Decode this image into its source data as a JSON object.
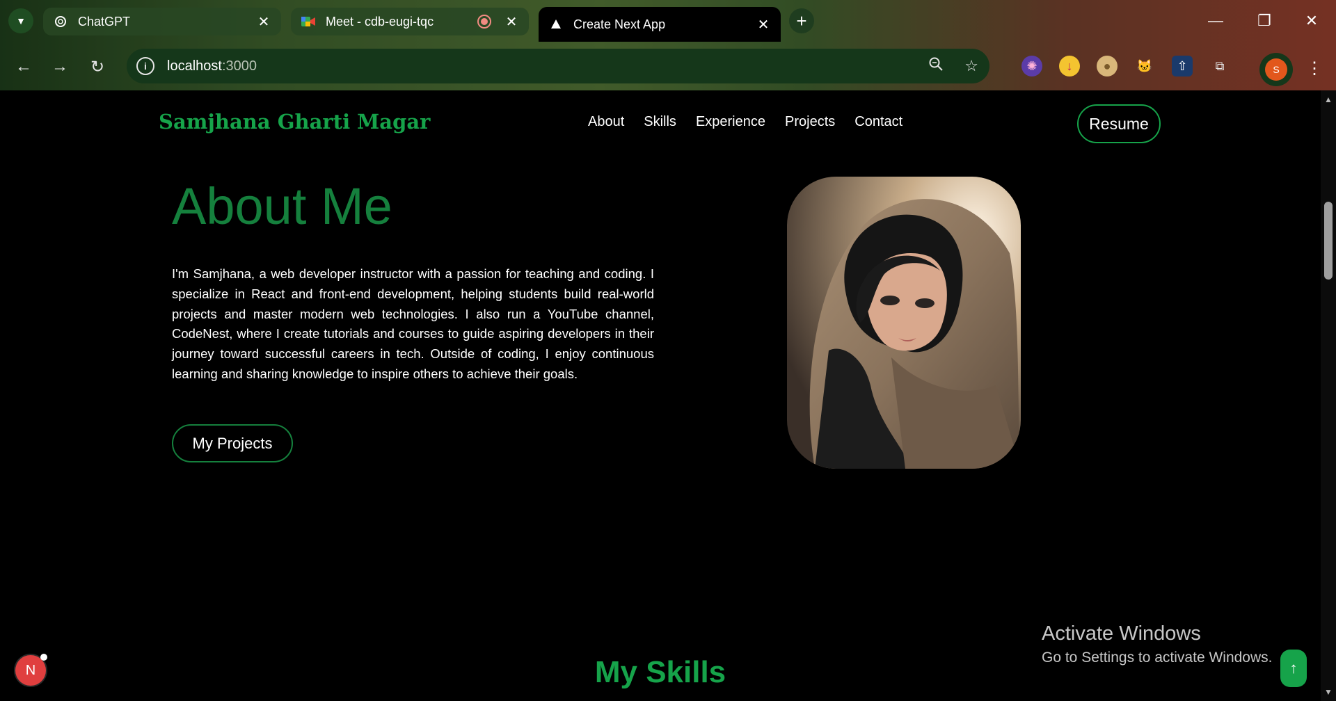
{
  "browser": {
    "tabs": [
      {
        "title": "ChatGPT",
        "icon": "chatgpt-icon"
      },
      {
        "title": "Meet - cdb-eugi-tqc",
        "icon": "meet-icon"
      },
      {
        "title": "Create Next App",
        "icon": "nextjs-triangle-icon"
      }
    ],
    "url_host": "localhost",
    "url_port": ":3000",
    "profile_initial": "S"
  },
  "site": {
    "brand": "Samjhana Gharti Magar",
    "nav": [
      "About",
      "Skills",
      "Experience",
      "Projects",
      "Contact"
    ],
    "resume_label": "Resume"
  },
  "about": {
    "title": "About Me",
    "paragraph": "I'm Samjhana, a web developer instructor with a passion for teaching and coding. I specialize in React and front-end development, helping students build real-world projects and master modern web technologies. I also run a YouTube channel, CodeNest, where I create tutorials and courses to guide aspiring developers in their journey toward successful careers in tech. Outside of coding, I enjoy continuous learning and sharing knowledge to inspire others to achieve their goals.",
    "button_label": "My Projects"
  },
  "skills": {
    "title": "My Skills"
  },
  "overlay": {
    "activate_line1": "Activate Windows",
    "activate_line2": "Go to Settings to activate Windows.",
    "next_badge": "N",
    "to_top_icon": "↑"
  },
  "colors": {
    "accent": "#16a34a",
    "title_green": "#15803d",
    "background": "#000000"
  }
}
